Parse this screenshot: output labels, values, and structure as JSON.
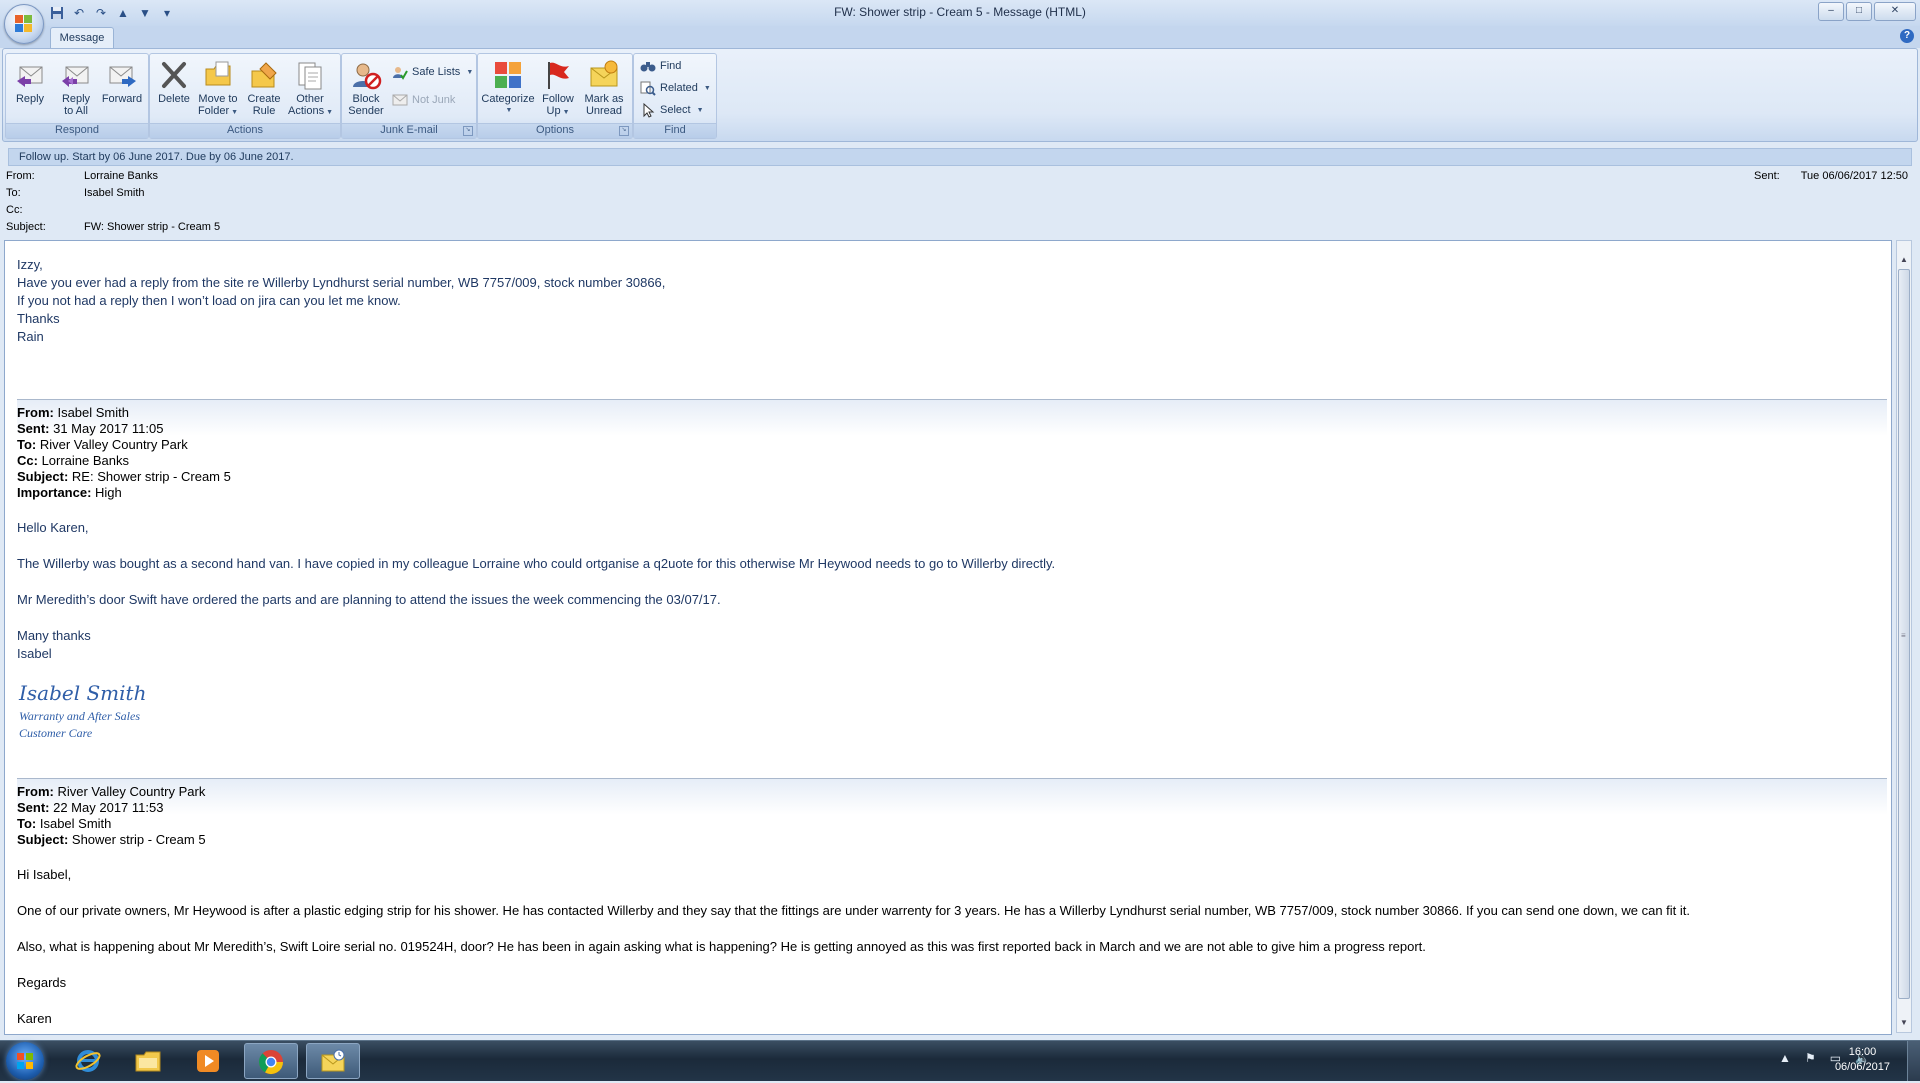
{
  "window": {
    "title": "FW: Shower strip - Cream 5 - Message (HTML)",
    "controls": {
      "minimize": "–",
      "maximize": "□",
      "close": "✕"
    }
  },
  "ribbon": {
    "tab": "Message",
    "help": "?",
    "groups": {
      "respond": {
        "label": "Respond",
        "reply": "Reply",
        "reply_all_1": "Reply",
        "reply_all_2": "to All",
        "forward": "Forward"
      },
      "actions": {
        "label": "Actions",
        "delete": "Delete",
        "move_1": "Move to",
        "move_2": "Folder",
        "rule_1": "Create",
        "rule_2": "Rule",
        "other_1": "Other",
        "other_2": "Actions"
      },
      "junk": {
        "label": "Junk E-mail",
        "block_1": "Block",
        "block_2": "Sender",
        "safe_lists": "Safe Lists",
        "not_junk": "Not Junk"
      },
      "options": {
        "label": "Options",
        "categorize": "Categorize",
        "follow_1": "Follow",
        "follow_2": "Up",
        "mark_1": "Mark as",
        "mark_2": "Unread"
      },
      "find": {
        "label": "Find",
        "find": "Find",
        "related": "Related",
        "select": "Select"
      }
    }
  },
  "header": {
    "infobar": "Follow up.  Start by 06 June 2017.  Due by 06 June 2017.",
    "from_label": "From:",
    "from": "Lorraine Banks",
    "to_label": "To:",
    "to": "Isabel Smith",
    "cc_label": "Cc:",
    "cc": "",
    "subject_label": "Subject:",
    "subject": "FW: Shower strip - Cream 5",
    "sent_label": "Sent:",
    "sent": "Tue 06/06/2017 12:50"
  },
  "body": {
    "msg1": [
      "Izzy,",
      "Have you ever had a reply from the site re Willerby Lyndhurst serial number, WB 7757/009, stock number 30866,",
      "If you not had a reply then I won’t load on jira can you let me know.",
      "Thanks",
      "Rain"
    ],
    "fwd1": {
      "from_label": "From:",
      "from": " Isabel Smith",
      "sent_label": "Sent:",
      "sent": " 31 May 2017 11:05",
      "to_label": "To:",
      "to": " River Valley Country Park",
      "cc_label": "Cc:",
      "cc": " Lorraine Banks",
      "subject_label": "Subject:",
      "subject": " RE: Shower strip - Cream 5",
      "importance_label": "Importance:",
      "importance": " High"
    },
    "msg2": {
      "greeting": "Hello Karen,",
      "p1": "The Willerby was bought as a second hand van. I have copied in my colleague Lorraine who could ortganise a q2uote for this otherwise Mr Heywood needs to go to Willerby directly.",
      "p2": "Mr Meredith’s door Swift have ordered the parts and are planning to attend the issues the week commencing the 03/07/17.",
      "thanks": "Many thanks",
      "name": "Isabel",
      "sig_name": "Isabel Smith",
      "sig_line1": "Warranty and After Sales",
      "sig_line2": "Customer Care"
    },
    "fwd2": {
      "from_label": "From:",
      "from": " River Valley Country Park",
      "sent_label": "Sent:",
      "sent": " 22 May 2017 11:53",
      "to_label": "To:",
      "to": " Isabel Smith",
      "subject_label": "Subject:",
      "subject": " Shower strip - Cream 5"
    },
    "msg3": {
      "greeting": "Hi Isabel,",
      "p1": "One of our private owners, Mr Heywood is after a plastic edging strip for his shower.  He has contacted Willerby and they say that the fittings are under warrenty for 3 years.  He has a Willerby Lyndhurst serial number, WB 7757/009, stock number 30866.  If you can send one down, we can fit it.",
      "p2": "Also, what is happening about Mr Meredith’s, Swift Loire serial no. 019524H, door?  He has been in again asking what is happening?  He is getting annoyed as this was first reported back in March and we are not able to give him a progress report.",
      "regards": "Regards",
      "name": "Karen"
    }
  },
  "taskbar": {
    "time": "16:00",
    "date": "06/06/2017"
  },
  "colors": {
    "accent": "#2f5ea8",
    "body_text": "#1f3864"
  }
}
